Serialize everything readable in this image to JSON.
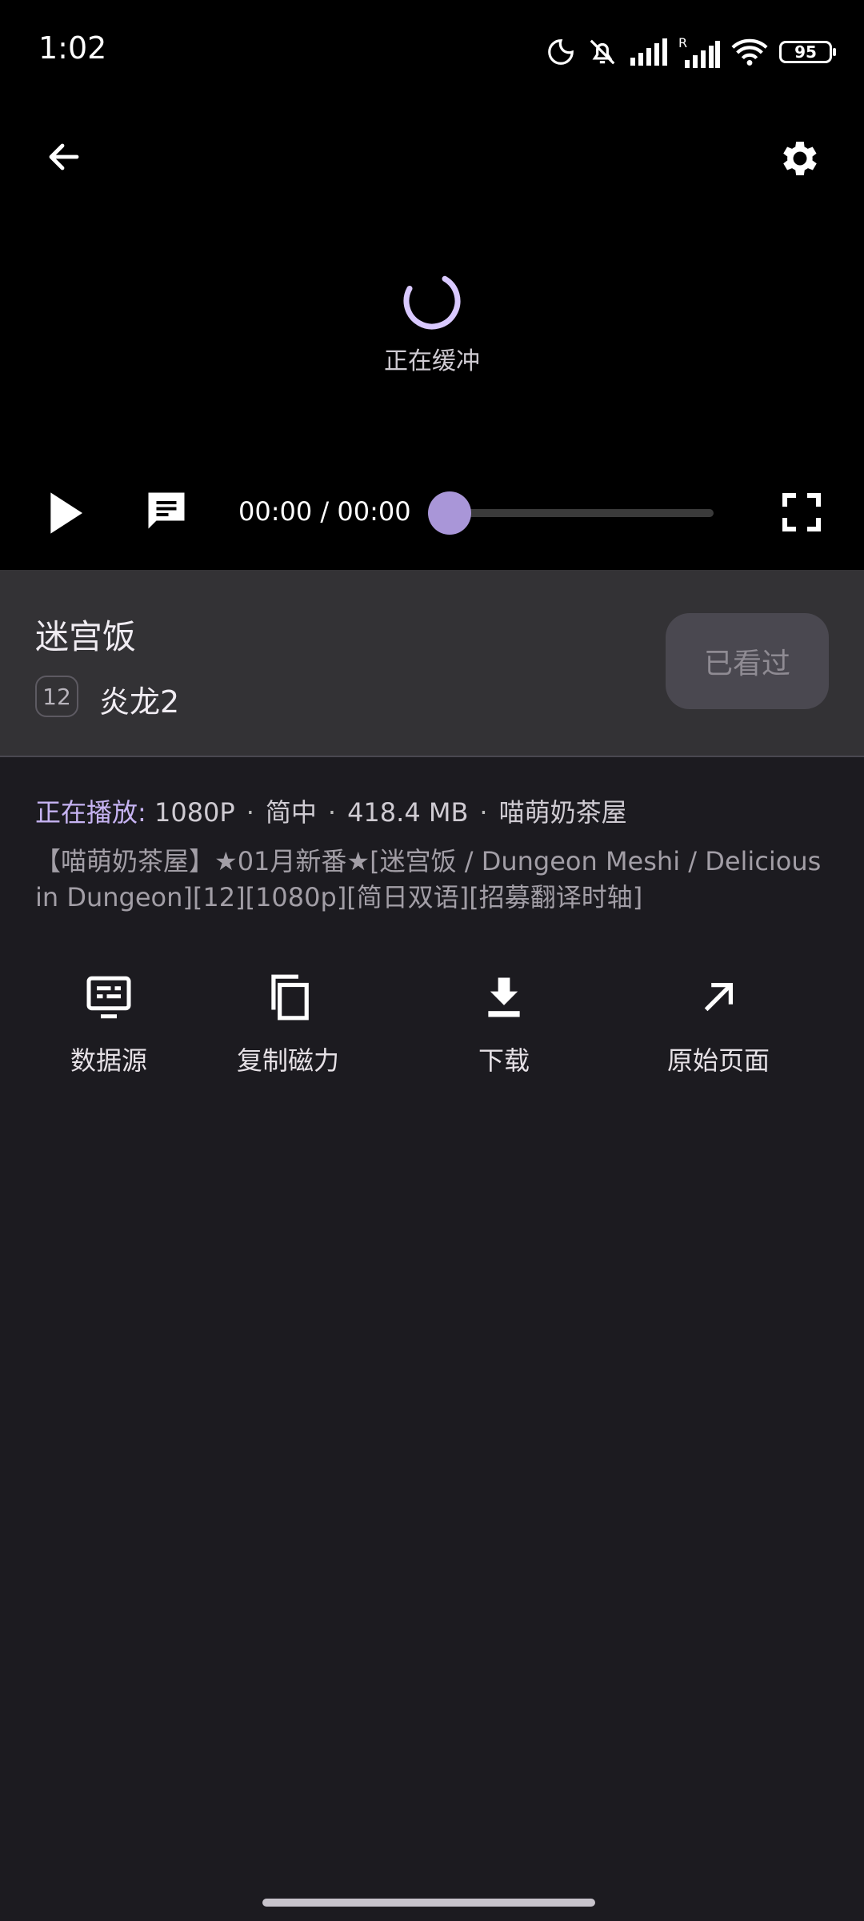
{
  "status_bar": {
    "time": "1:02",
    "battery": "95",
    "icons": [
      "moon-icon",
      "bell-off-icon",
      "signal-icon",
      "signal-roaming-icon",
      "wifi-icon",
      "battery-icon"
    ]
  },
  "player": {
    "buffering_text": "正在缓冲",
    "time_display": "00:00 / 00:00",
    "progress": 0,
    "accent_color": "#a996d8"
  },
  "anime": {
    "title": "迷宫饭",
    "episode_number": "12",
    "episode_title": "炎龙2",
    "watched_button": "已看过"
  },
  "playing": {
    "label": "正在播放:",
    "resolution": "1080P",
    "subtitle": "简中",
    "size": "418.4 MB",
    "group": "喵萌奶茶屋",
    "file_name": "【喵萌奶茶屋】★01月新番★[迷宫饭 / Dungeon Meshi / Delicious in Dungeon][12][1080p][简日双语][招募翻译时轴]"
  },
  "actions": {
    "data_source": "数据源",
    "copy_magnet": "复制磁力",
    "download": "下载",
    "original_page": "原始页面"
  }
}
